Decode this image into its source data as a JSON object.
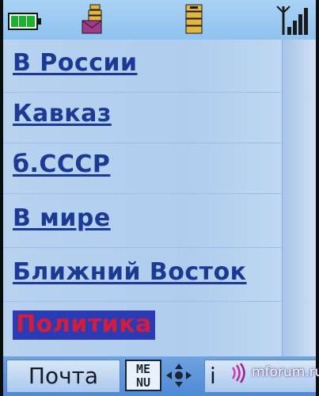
{
  "menu": {
    "items": [
      {
        "label": "В России"
      },
      {
        "label": "Кавказ"
      },
      {
        "label": "б.СССР"
      },
      {
        "label": "В мире"
      },
      {
        "label": "Ближний Восток"
      },
      {
        "label": "Политика",
        "selected": true
      }
    ]
  },
  "softkeys": {
    "left_label": "Почта",
    "menu_button_top": "ME",
    "menu_button_bottom": "NU",
    "right_label": "i"
  },
  "watermark": {
    "text": "mforum.ru"
  },
  "colors": {
    "link": "#1c3a93",
    "selected_bg": "#2a3bb6",
    "selected_text": "#d61b3b",
    "statusbar": "#a9d2f4"
  }
}
